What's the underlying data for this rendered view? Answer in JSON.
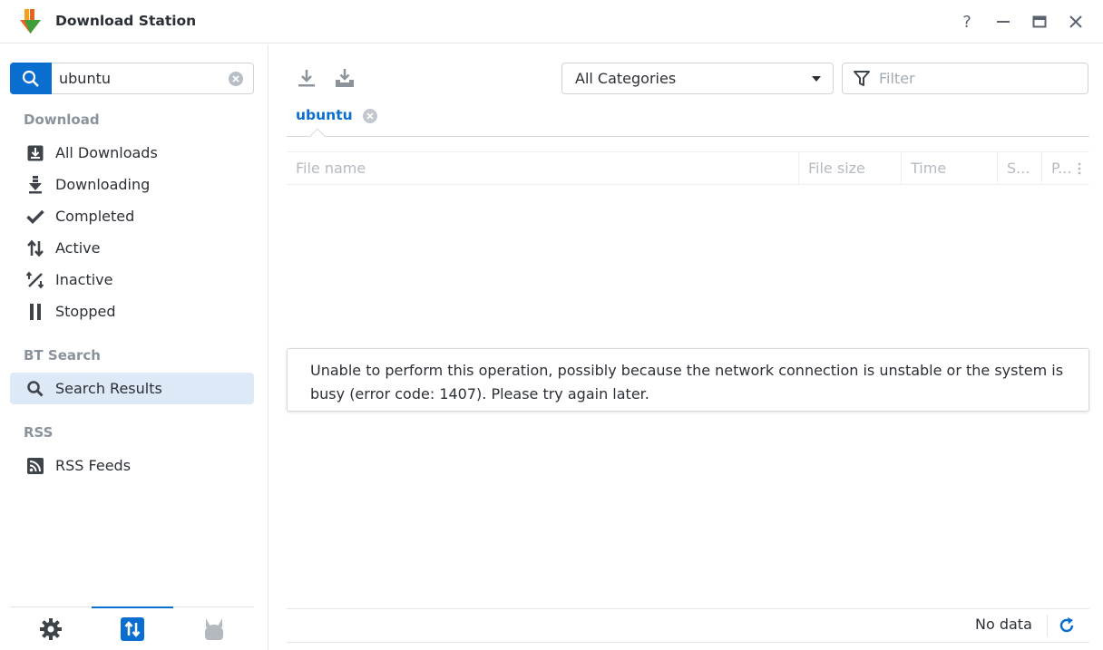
{
  "window": {
    "title": "Download Station",
    "help_label": "?"
  },
  "search": {
    "value": "ubuntu"
  },
  "sidebar": {
    "sections": [
      {
        "title": "Download",
        "items": [
          {
            "label": "All Downloads",
            "icon": "download-box-icon"
          },
          {
            "label": "Downloading",
            "icon": "downloading-arrow-icon"
          },
          {
            "label": "Completed",
            "icon": "checkmark-icon"
          },
          {
            "label": "Active",
            "icon": "up-down-arrows-icon"
          },
          {
            "label": "Inactive",
            "icon": "percent-slash-icon"
          },
          {
            "label": "Stopped",
            "icon": "pause-icon"
          }
        ]
      },
      {
        "title": "BT Search",
        "items": [
          {
            "label": "Search Results",
            "icon": "search-icon",
            "selected": true
          }
        ]
      },
      {
        "title": "RSS",
        "items": [
          {
            "label": "RSS Feeds",
            "icon": "rss-icon"
          }
        ]
      }
    ],
    "bottom_tabs": [
      {
        "icon": "gear-icon"
      },
      {
        "icon": "transfer-icon",
        "active": true
      },
      {
        "icon": "emule-donkey-icon"
      }
    ]
  },
  "toolbar": {
    "category_selected": "All Categories",
    "filter_placeholder": "Filter"
  },
  "results_tab": {
    "label": "ubuntu"
  },
  "grid": {
    "columns": [
      "File name",
      "File size",
      "Time",
      "S...",
      "P..."
    ]
  },
  "error_message": "Unable to perform this operation, possibly because the network connection is unstable or the system is busy (error code: 1407). Please try again later.",
  "footer": {
    "status": "No data"
  },
  "colors": {
    "accent": "#0a6ed1",
    "selected_bg": "#dde9f7",
    "section_title": "#8a929c"
  }
}
